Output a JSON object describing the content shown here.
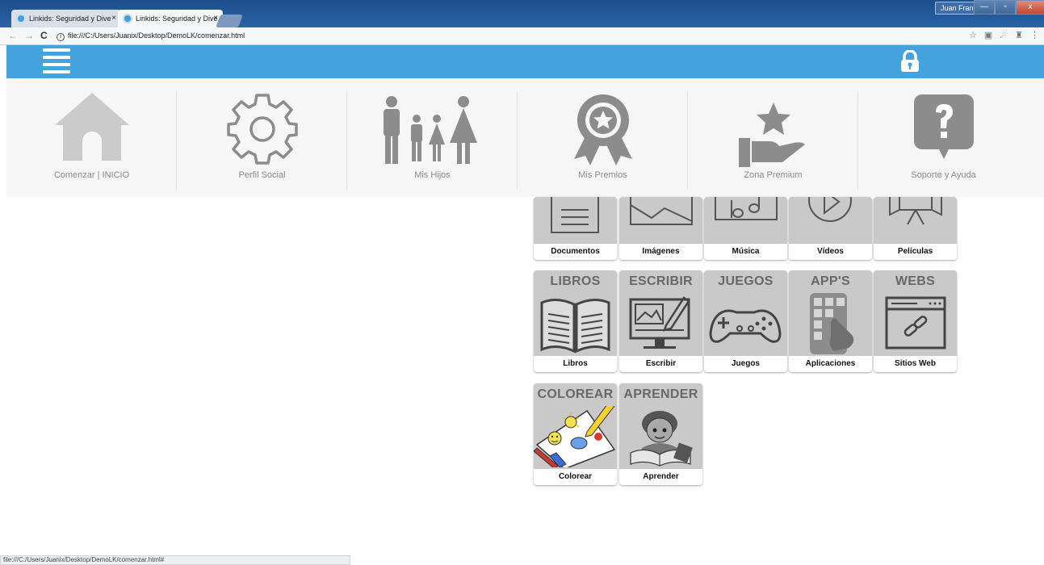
{
  "browser": {
    "tabs": [
      {
        "title": "Linkids: Seguridad y Dive",
        "close": "×"
      },
      {
        "title": "Linkids: Seguridad y Dive",
        "close": "×"
      }
    ],
    "user_name": "Juan Francisco",
    "window_controls": {
      "minimize": "—",
      "maximize": "▫",
      "close": "x"
    },
    "url": "file:///C:/Users/Juanix/Desktop/DemoLK/comenzar.html",
    "nav": {
      "back": "←",
      "forward": "→",
      "reload": "C",
      "info": "i"
    },
    "extensions": [
      "☆",
      "▣",
      "☄",
      "♜",
      "⋮"
    ],
    "status_text": "file:///C:/Users/Juanix/Desktop/DemoLK/comenzar.html#"
  },
  "header": {
    "menu_icon": "hamburger-menu-icon",
    "lock_icon": "padlock-icon",
    "accent_color": "#44a3dc"
  },
  "nav_items": [
    {
      "label": "Comenzar | INICIO",
      "icon": "home-icon"
    },
    {
      "label": "Perfil Social",
      "icon": "gear-icon"
    },
    {
      "label": "Mis Hijos",
      "icon": "family-icon"
    },
    {
      "label": "Mis Premios",
      "icon": "award-ribbon-icon"
    },
    {
      "label": "Zona Premium",
      "icon": "hand-star-icon"
    },
    {
      "label": "Soporte y Ayuda",
      "icon": "help-bubble-icon"
    }
  ],
  "tiles_row1": [
    {
      "label": "Documentos",
      "icon": "document-icon"
    },
    {
      "label": "Imágenes",
      "icon": "image-icon"
    },
    {
      "label": "Música",
      "icon": "music-icon"
    },
    {
      "label": "Vídeos",
      "icon": "video-play-icon"
    },
    {
      "label": "Películas",
      "icon": "movie-camera-icon"
    }
  ],
  "tiles_row2": [
    {
      "heading": "LIBROS",
      "label": "Libros",
      "icon": "book-icon"
    },
    {
      "heading": "ESCRIBIR",
      "label": "Escribir",
      "icon": "monitor-pencil-icon"
    },
    {
      "heading": "JUEGOS",
      "label": "Juegos",
      "icon": "gamepad-icon"
    },
    {
      "heading": "APP'S",
      "label": "Aplicaciones",
      "icon": "phone-apps-icon"
    },
    {
      "heading": "WEBS",
      "label": "Sitios Web",
      "icon": "browser-link-icon"
    }
  ],
  "tiles_row3": [
    {
      "heading": "COLOREAR",
      "label": "Colorear",
      "icon": "coloring-illustration"
    },
    {
      "heading": "APRENDER",
      "label": "Aprender",
      "icon": "child-reading-illustration"
    }
  ]
}
